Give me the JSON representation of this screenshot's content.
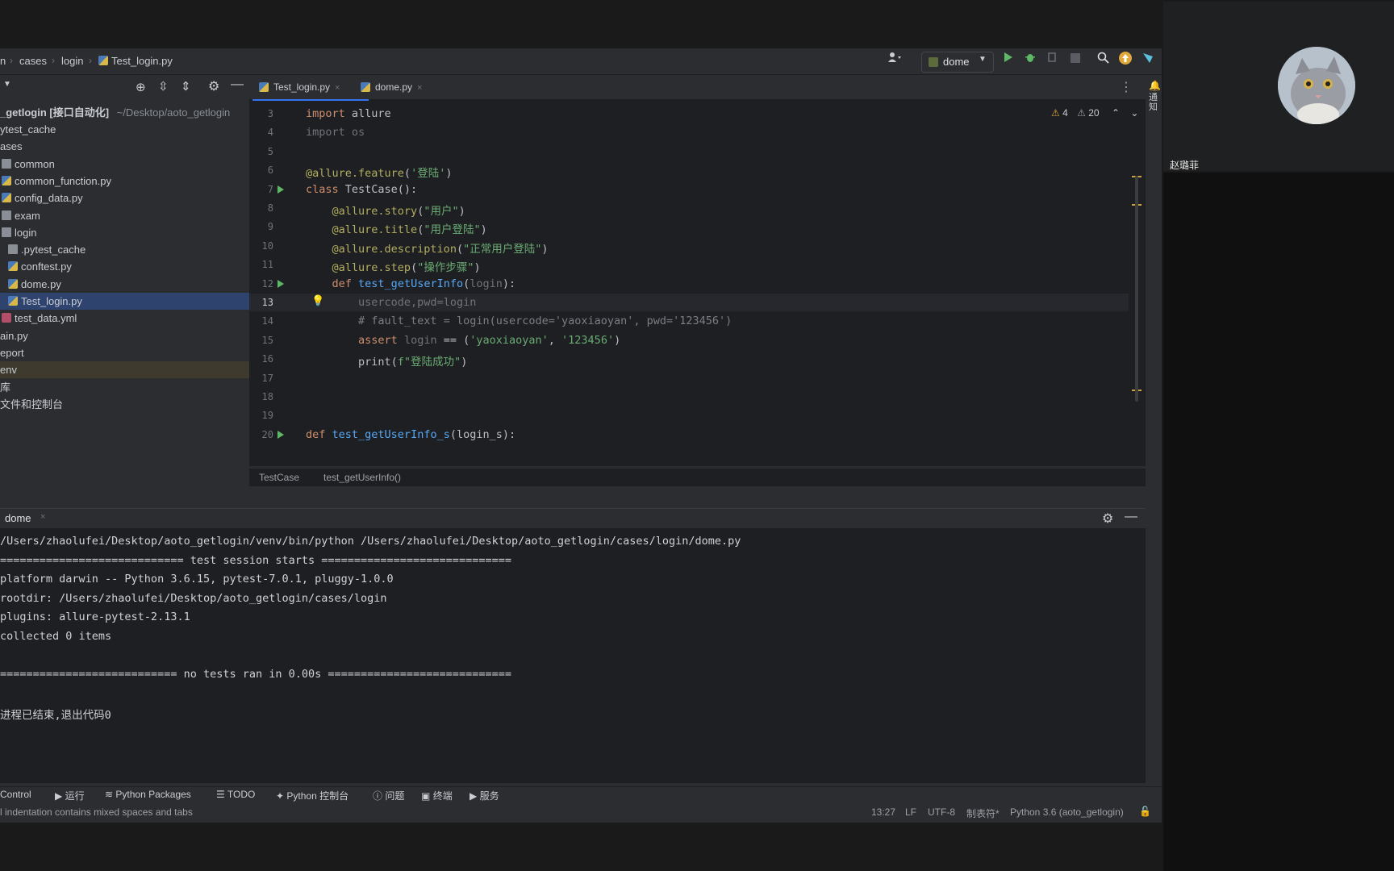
{
  "breadcrumb": {
    "items": [
      "n",
      "cases",
      "login",
      "Test_login.py"
    ]
  },
  "run_config": {
    "name": "dome"
  },
  "project": {
    "root_label": "_getlogin [接口自动化]",
    "root_path": "~/Desktop/aoto_getlogin",
    "items": [
      {
        "label": "ytest_cache",
        "indent": 0,
        "icon": "none"
      },
      {
        "label": "ases",
        "indent": 0,
        "icon": "none"
      },
      {
        "label": "common",
        "indent": 1,
        "icon": "folder"
      },
      {
        "label": "common_function.py",
        "indent": 1,
        "icon": "py"
      },
      {
        "label": "config_data.py",
        "indent": 1,
        "icon": "py"
      },
      {
        "label": "exam",
        "indent": 1,
        "icon": "folder"
      },
      {
        "label": "login",
        "indent": 1,
        "icon": "folder"
      },
      {
        "label": ".pytest_cache",
        "indent": 2,
        "icon": "folder"
      },
      {
        "label": "conftest.py",
        "indent": 2,
        "icon": "py"
      },
      {
        "label": "dome.py",
        "indent": 2,
        "icon": "py"
      },
      {
        "label": "Test_login.py",
        "indent": 2,
        "icon": "py",
        "selected": true
      },
      {
        "label": "test_data.yml",
        "indent": 1,
        "icon": "yml"
      },
      {
        "label": "ain.py",
        "indent": 0,
        "icon": "none"
      },
      {
        "label": "eport",
        "indent": 0,
        "icon": "none"
      },
      {
        "label": "env",
        "indent": 0,
        "icon": "none",
        "highlight": true
      },
      {
        "label": "库",
        "indent": 0,
        "icon": "none"
      },
      {
        "label": "文件和控制台",
        "indent": 0,
        "icon": "none"
      }
    ]
  },
  "editor": {
    "tabs": [
      {
        "label": "Test_login.py",
        "active": true
      },
      {
        "label": "dome.py",
        "active": false
      }
    ],
    "warnings": "4",
    "weak_warnings": "20",
    "lines": [
      {
        "num": "3",
        "html": "<span class=\"kw\">import</span> allure"
      },
      {
        "num": "4",
        "html": "<span class=\"dim\">import os</span>"
      },
      {
        "num": "5",
        "html": ""
      },
      {
        "num": "6",
        "html": "<span class=\"dec\">@allure.feature</span>(<span class=\"str\">'登陆'</span>)"
      },
      {
        "num": "7",
        "html": "<span class=\"kw\">class</span> TestCase():",
        "run": true
      },
      {
        "num": "8",
        "html": "    <span class=\"dec\">@allure.story</span>(<span class=\"str\">\"用户\"</span>)"
      },
      {
        "num": "9",
        "html": "    <span class=\"dec\">@allure.title</span>(<span class=\"str\">\"用户登陆\"</span>)"
      },
      {
        "num": "10",
        "html": "    <span class=\"dec\">@allure.description</span>(<span class=\"str\">\"正常用户登陆\"</span>)"
      },
      {
        "num": "11",
        "html": "    <span class=\"dec\">@allure.step</span>(<span class=\"str\">\"操作步骤\"</span>)"
      },
      {
        "num": "12",
        "html": "    <span class=\"kw\">def</span> <span class=\"fn\">test_getUserInfo</span>(<span class=\"dim\">login</span>):",
        "run": true
      },
      {
        "num": "13",
        "html": "        <span class=\"dim\">usercode,pwd=login</span>",
        "current": true
      },
      {
        "num": "14",
        "html": "        <span class=\"cmt\"># fault_text = login(usercode='yaoxiaoyan', pwd='123456')</span>"
      },
      {
        "num": "15",
        "html": "        <span class=\"kw\">assert</span> <span class=\"dim\">login</span> == (<span class=\"str\">'yaoxiaoyan'</span>, <span class=\"str\">'123456'</span>)"
      },
      {
        "num": "16",
        "html": "        print(<span class=\"str\">f\"登陆成功\"</span>)"
      },
      {
        "num": "17",
        "html": ""
      },
      {
        "num": "18",
        "html": ""
      },
      {
        "num": "19",
        "html": ""
      },
      {
        "num": "20",
        "html": "<span class=\"kw\">def</span> <span class=\"fn\">test_getUserInfo_s</span>(login_s):",
        "run": true
      }
    ],
    "crumbs": [
      "TestCase",
      "test_getUserInfo()"
    ]
  },
  "run": {
    "tab": "dome",
    "lines": [
      "/Users/zhaolufei/Desktop/aoto_getlogin/venv/bin/python /Users/zhaolufei/Desktop/aoto_getlogin/cases/login/dome.py",
      "============================ test session starts =============================",
      "platform darwin -- Python 3.6.15, pytest-7.0.1, pluggy-1.0.0",
      "rootdir: /Users/zhaolufei/Desktop/aoto_getlogin/cases/login",
      "plugins: allure-pytest-2.13.1",
      "collected 0 items",
      "",
      "=========================== no tests ran in 0.00s ============================",
      "",
      "进程已结束,退出代码0"
    ]
  },
  "bottom_tools": [
    "Control",
    "运行",
    "Python Packages",
    "TODO",
    "Python 控制台",
    "问题",
    "终端",
    "服务"
  ],
  "status": {
    "message": "l indentation contains mixed spaces and tabs",
    "position": "13:27",
    "line_sep": "LF",
    "encoding": "UTF-8",
    "indent": "制表符*",
    "interpreter": "Python 3.6 (aoto_getlogin)"
  },
  "notifications_label": "通知",
  "participant": {
    "name": "赵璐菲"
  }
}
